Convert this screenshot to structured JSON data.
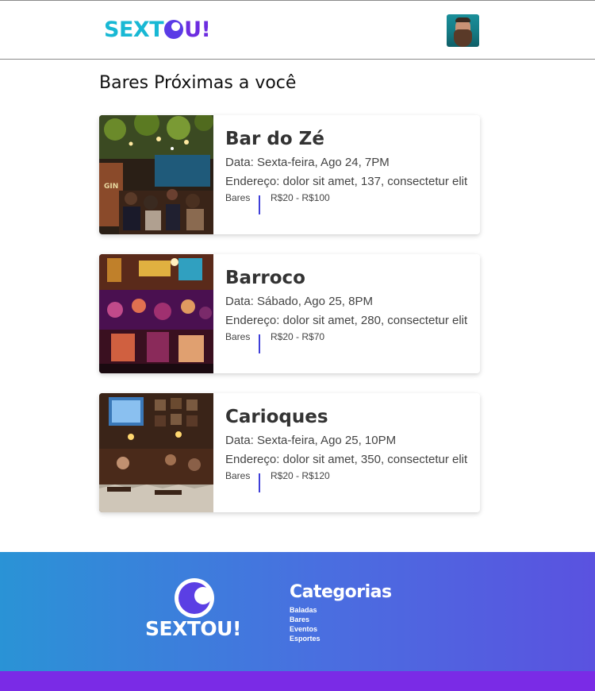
{
  "header": {
    "logo": {
      "part1": "SEXT",
      "part2": "U!"
    }
  },
  "main": {
    "title": "Bares Próximas a você",
    "cards": [
      {
        "name": "Bar do Zé",
        "date": "Data: Sexta-feira, Ago 24, 7PM",
        "address": "Endereço: dolor sit amet, 137, consectetur elit",
        "category": "Bares",
        "price": "R$20 - R$100",
        "sign": "GIN"
      },
      {
        "name": "Barroco",
        "date": "Data: Sábado, Ago 25, 8PM",
        "address": "Endereço: dolor sit amet, 280, consectetur elit",
        "category": "Bares",
        "price": "R$20 - R$70"
      },
      {
        "name": "Carioques",
        "date": "Data: Sexta-feira, Ago 25, 10PM",
        "address": "Endereço: dolor sit amet, 350, consectetur elit",
        "category": "Bares",
        "price": "R$20 - R$120"
      }
    ]
  },
  "footer": {
    "brand": "SEXTOU!",
    "categories_title": "Categorias",
    "categories": [
      "Baladas",
      "Bares",
      "Eventos",
      "Esportes"
    ]
  },
  "colors": {
    "accent": "#3f3fd8",
    "footer_gradient_start": "#2a93d6",
    "footer_gradient_end": "#5a52e0",
    "footer_bar": "#7a2be6"
  }
}
